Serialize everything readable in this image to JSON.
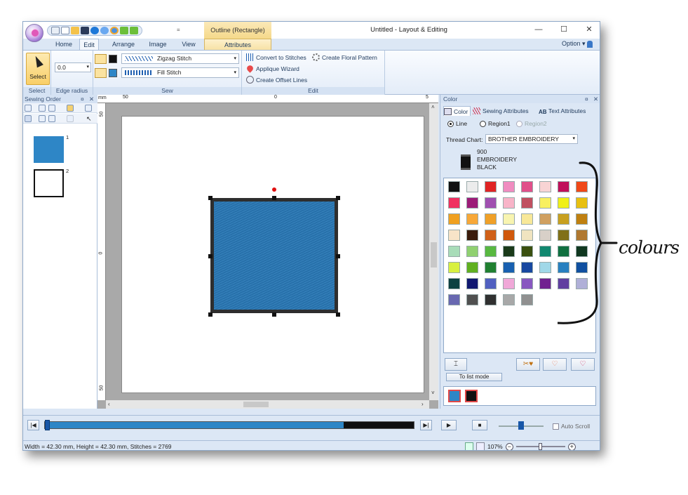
{
  "titlebar": {
    "window_title": "Untitled - Layout & Editing",
    "context_tab_title": "Outline (Rectangle)",
    "qat_more": "=",
    "minimize": "—",
    "maximize": "☐",
    "close": "✕"
  },
  "tabs": [
    {
      "label": "Home"
    },
    {
      "label": "Edit"
    },
    {
      "label": "Arrange"
    },
    {
      "label": "Image"
    },
    {
      "label": "View"
    },
    {
      "label": "Attributes"
    }
  ],
  "option_label": "Option",
  "ribbon": {
    "select_label": "Select",
    "edge_radius_value": "0.0",
    "groups": {
      "select": "Select",
      "edge_radius": "Edge radius",
      "sew": "Sew",
      "edit": "Edit"
    },
    "sew": {
      "line_stitch": "Zigzag Stitch",
      "region_stitch": "Fill Stitch"
    },
    "edit": {
      "convert": "Convert to Stitches",
      "floral": "Create Floral Pattern",
      "applique": "Applique Wizard",
      "offset": "Create Offset Lines"
    }
  },
  "sewing_order": {
    "title": "Sewing Order",
    "items": [
      {
        "num": "1",
        "color": "#2e86c6"
      },
      {
        "num": "2",
        "color": "#111111"
      }
    ]
  },
  "canvas": {
    "ruler_unit": "mm",
    "ruler_top": [
      "50",
      "0",
      "5"
    ],
    "ruler_left": [
      "50",
      "0",
      "50"
    ]
  },
  "color_panel": {
    "title": "Color",
    "tabs": [
      "Color",
      "Sewing Attributes",
      "Text Attributes"
    ],
    "radios": [
      "Line",
      "Region1",
      "Region2"
    ],
    "thread_chart_label": "Thread Chart:",
    "thread_chart_value": "BROTHER EMBROIDERY",
    "thread_code": "900",
    "thread_brand": "EMBROIDERY",
    "thread_name": "BLACK",
    "swatches": [
      "#111111",
      "#ececec",
      "#e02424",
      "#f08cc0",
      "#e0508a",
      "#f8d4d4",
      "#c0105a",
      "#f04818",
      "#f03060",
      "#9c1c78",
      "#a050b0",
      "#f8b4c8",
      "#c05060",
      "#f8f060",
      "#f0f018",
      "#e8c010",
      "#f0a020",
      "#f8a838",
      "#f0a028",
      "#f8f4b0",
      "#f8e898",
      "#d0a060",
      "#c8a020",
      "#c08010",
      "#f8e4c8",
      "#3a1c0c",
      "#d06018",
      "#d0580c",
      "#f0e4c0",
      "#d8d0c8",
      "#807018",
      "#b07830",
      "#a8dcb8",
      "#90d070",
      "#58b840",
      "#1a3a1a",
      "#3a5010",
      "#108870",
      "#107040",
      "#103820",
      "#d8f040",
      "#60b020",
      "#208030",
      "#1860b0",
      "#1848a0",
      "#a0d8e8",
      "#2880c0",
      "#1050a0",
      "#0c4040",
      "#101870",
      "#5060c0",
      "#f0a8d8",
      "#8858c0",
      "#702090",
      "#6040a0",
      "#b0b0d8",
      "#6868b0",
      "#505050",
      "#303030",
      "#a8a8a8",
      "#909090"
    ],
    "list_mode": "To list mode",
    "used_colors": [
      "#2e86c6",
      "#111111"
    ]
  },
  "playbar": {
    "progress_fraction": 0.81,
    "auto_scroll": "Auto Scroll"
  },
  "status": {
    "text": "Width = 42.30 mm, Height = 42.30 mm, Stitches = 2769",
    "zoom": "107%"
  },
  "annotation": {
    "text": "colours"
  }
}
